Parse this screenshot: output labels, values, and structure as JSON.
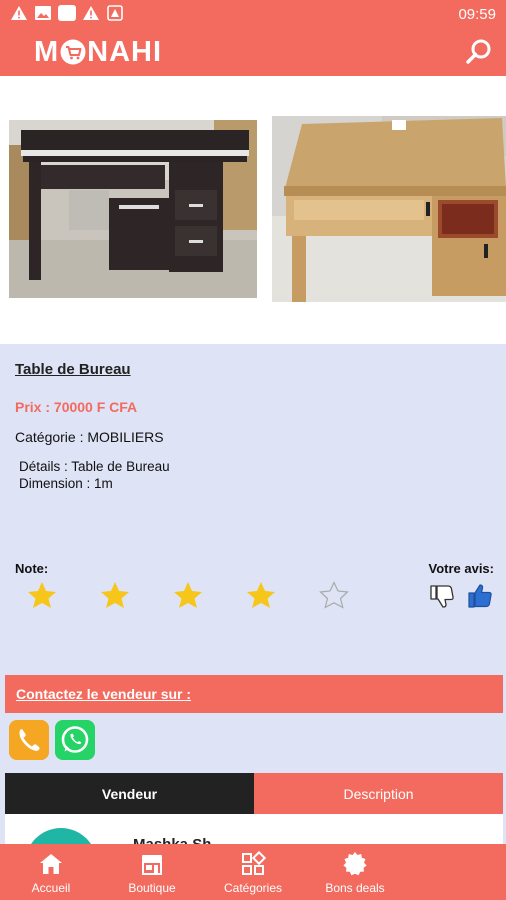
{
  "status_bar": {
    "time": "09:59",
    "icons": [
      "warning-icon",
      "gallery-icon",
      "app-icon",
      "warning-icon",
      "notification-icon"
    ]
  },
  "header": {
    "logo_left": "M",
    "logo_right": "NAHI",
    "logo_full": "MONAHI",
    "search_icon": "search-icon"
  },
  "product": {
    "title": "Table de Bureau",
    "price": "Prix : 70000 F CFA",
    "category": "Catégorie : MOBILIERS",
    "details_line1": "Détails : Table de Bureau",
    "details_line2": "Dimension : 1m",
    "images": [
      "dark-desk-photo",
      "wood-desk-photo"
    ]
  },
  "rating": {
    "note_label": "Note:",
    "stars_filled": 4,
    "stars_total": 5,
    "avis_label": "Votre avis:"
  },
  "contact": {
    "label": "Contactez le vendeur sur :"
  },
  "tabs": {
    "vendeur": "Vendeur",
    "description": "Description"
  },
  "seller": {
    "name": "Mashka Sh"
  },
  "bottom_nav": {
    "items": [
      {
        "label": "Accueil",
        "icon": "home-icon"
      },
      {
        "label": "Boutique",
        "icon": "shop-icon"
      },
      {
        "label": "Catégories",
        "icon": "categories-icon"
      },
      {
        "label": "Bons deals",
        "icon": "deals-icon"
      }
    ]
  },
  "colors": {
    "primary": "#f26b5e",
    "panel": "#dfe3f6",
    "star": "#f7c61a",
    "dark": "#222222"
  }
}
